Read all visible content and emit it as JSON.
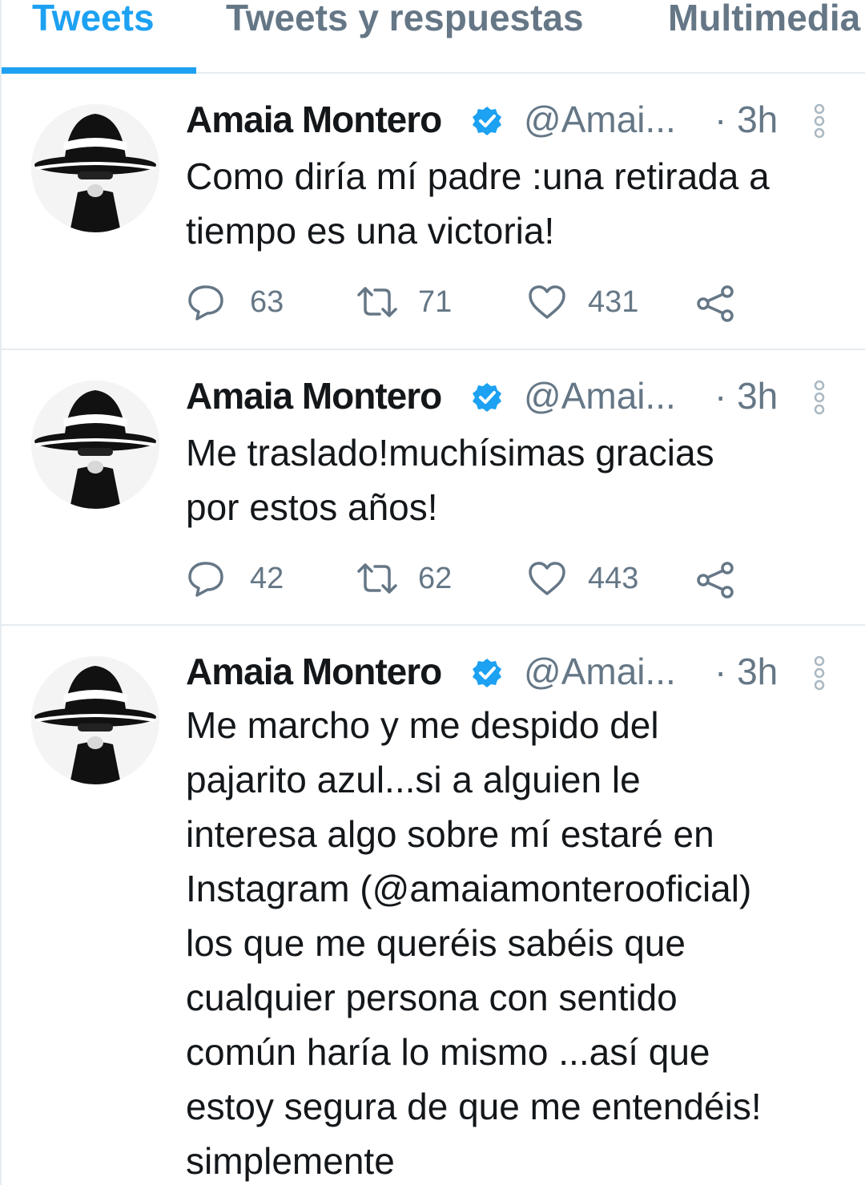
{
  "tabs": [
    {
      "label": "Tweets",
      "active": true
    },
    {
      "label": "Tweets y respuestas",
      "active": false
    },
    {
      "label": "Multimedia",
      "active": false
    }
  ],
  "colors": {
    "accent": "#1da1f2",
    "secondary_text": "#657786",
    "divider": "#e6ecf0"
  },
  "tweets": [
    {
      "name": "Amaia Montero",
      "handle": "@Amai...",
      "time": "· 3h",
      "text": "Como diría mí padre :una retirada a\ntiempo es una victoria!",
      "replies": "63",
      "retweets": "71",
      "likes": "431"
    },
    {
      "name": "Amaia Montero",
      "handle": "@Amai...",
      "time": "· 3h",
      "text": "Me traslado!muchísimas gracias\npor estos años!",
      "replies": "42",
      "retweets": "62",
      "likes": "443"
    },
    {
      "name": "Amaia Montero",
      "handle": "@Amai...",
      "time": "· 3h",
      "text": "Me marcho y me despido del\npajarito azul...si a alguien le\ninteresa algo sobre mí estaré en\nInstagram (@amaiamonterooficial)\nlos que me queréis sabéis que\ncualquier persona con sentido\ncomún haría lo mismo ...así que\nestoy segura de que me entendéis!\nsimplemente"
    }
  ],
  "icons": {
    "verified": "verified-badge-icon",
    "more": "more-vertical-icon",
    "reply": "reply-icon",
    "retweet": "retweet-icon",
    "like": "heart-icon",
    "share": "share-icon"
  }
}
